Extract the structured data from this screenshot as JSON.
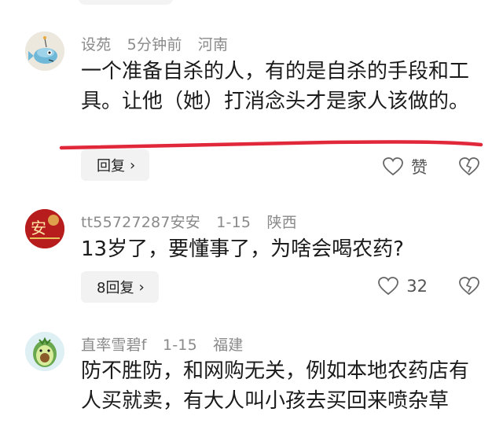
{
  "comments": [
    {
      "author": "设苑",
      "time": "5分钟前",
      "location": "河南",
      "text": "一个准备自杀的人，有的是自杀的手段和工具。让他（她）打消念头才是家人该做的。",
      "reply_label": "回复",
      "like_label": "赞"
    },
    {
      "author": "tt55727287安安",
      "time": "1-15",
      "location": "陕西",
      "text": "13岁了，要懂事了，为啥会喝农药?",
      "reply_label": "8回复",
      "like_label": "32"
    },
    {
      "author": "直率雪碧f",
      "time": "1-15",
      "location": "福建",
      "text": "防不胜防，和网购无关，例如本地农药店有人买就卖，有大人叫小孩去买回来喷杂草"
    }
  ],
  "avatar_badge_text": "安",
  "colors": {
    "annotation": "#e0283a",
    "meta": "#8a8a8a",
    "reply_bg": "#f2f2f2"
  }
}
